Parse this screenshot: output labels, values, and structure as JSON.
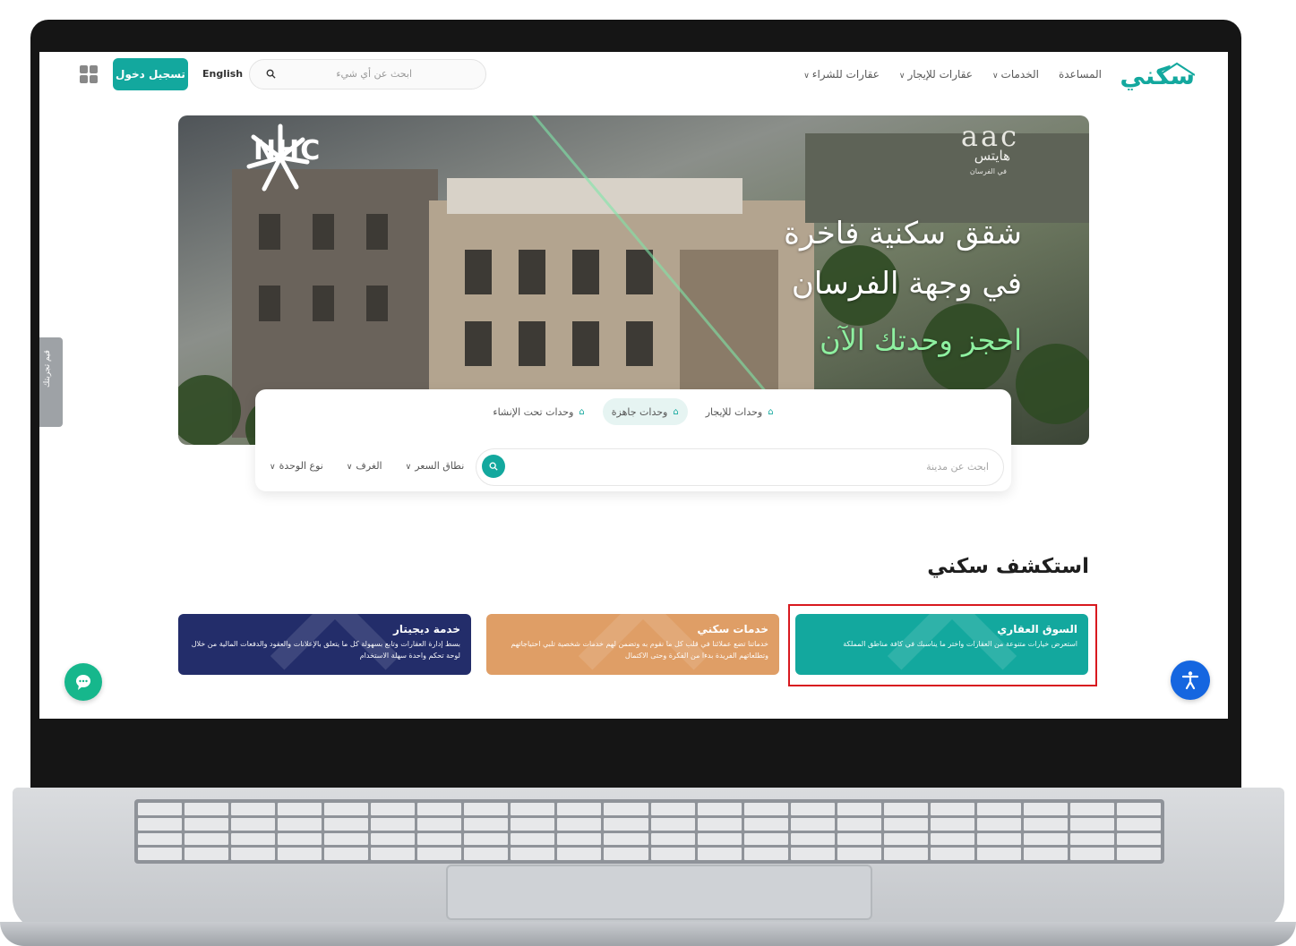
{
  "header": {
    "logo": "سكني",
    "nav": [
      {
        "label": "عقارات للشراء",
        "has_dropdown": true
      },
      {
        "label": "عقارات للإيجار",
        "has_dropdown": true
      },
      {
        "label": "الخدمات",
        "has_dropdown": true
      },
      {
        "label": "المساعدة",
        "has_dropdown": false
      }
    ],
    "search_placeholder": "ابحث عن أي شيء",
    "language": "English",
    "login": "تسجيل دخول"
  },
  "banner": {
    "brand_logo": "NHC",
    "project_logo": "aac",
    "project_name": "هايتس",
    "project_location": "في الفرسان",
    "headline_1": "شقق سكنية فاخرة",
    "headline_2": "في وجهة الفرسان",
    "headline_3": "احجز وحدتك الآن"
  },
  "search": {
    "tabs": [
      {
        "label": "وحدات تحت الإنشاء",
        "active": false
      },
      {
        "label": "وحدات جاهزة",
        "active": true
      },
      {
        "label": "وحدات للإيجار",
        "active": false
      }
    ],
    "city_placeholder": "ابحث عن مدينة",
    "filters": [
      "نوع الوحدة",
      "الغرف",
      "نطاق السعر"
    ]
  },
  "side_tab": "قيم تجربتك",
  "explore": {
    "title": "استكشف سكني",
    "cards": [
      {
        "title": "السوق العقاري",
        "desc": "استعرض خيارات متنوعة من العقارات واختر ما يناسبك في كافة مناطق المملكة",
        "color": "#13a89e"
      },
      {
        "title": "خدمات سكني",
        "desc": "خدماتنا تضع عملائنا في قلب كل ما نقوم به وتضمن لهم خدمات شخصية تلبي احتياجاتهم وتطلعاتهم الفريدة بدءا من الفكرة وحتى الاكتمال",
        "color": "#df9e66"
      },
      {
        "title": "خدمة ديجيتار",
        "desc": "بسط إدارة العقارات وتابع بسهولة كل ما يتعلق بالإعلانات والعقود والدفعات المالية من خلال لوحة تحكم واحدة سهلة الاستخدام",
        "color": "#232d6a"
      }
    ]
  },
  "colors": {
    "brand": "#13a89e",
    "highlight": "#d8191f",
    "accessibility": "#1566e0",
    "chat": "#16b78c"
  }
}
